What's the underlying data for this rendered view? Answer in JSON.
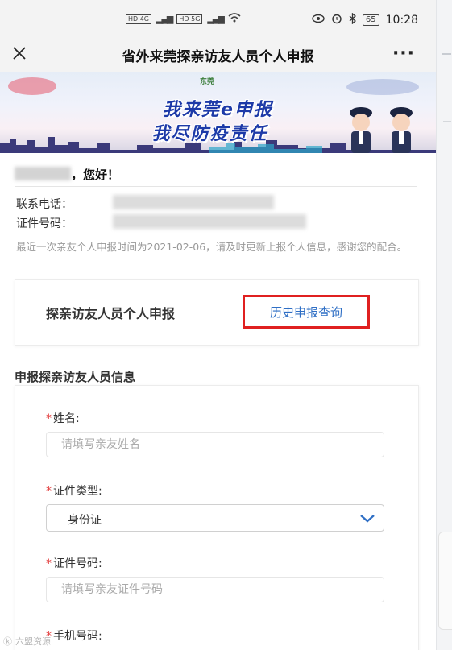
{
  "status_bar": {
    "network_left": "HD 4G",
    "network_right": "HD 5G",
    "battery": "65",
    "time": "10:28"
  },
  "header": {
    "title": "省外来莞探亲访友人员个人申报",
    "more": "···"
  },
  "banner": {
    "logo_text": "东莞",
    "slogan_line1": "我来莞e申报",
    "slogan_line2": "我尽防疫责任"
  },
  "user": {
    "greeting": "，您好！",
    "phone_label": "联系电话：",
    "id_label": "证件号码：",
    "notice": "最近一次亲友个人申报时间为2021-02-06，请及时更新上报个人信息，感谢您的配合。"
  },
  "report": {
    "title": "探亲访友人员个人申报",
    "history_link": "历史申报查询"
  },
  "form": {
    "section_title": "申报探亲访友人员信息",
    "fields": [
      {
        "required": "*",
        "label": "姓名:",
        "placeholder": "请填写亲友姓名"
      },
      {
        "required": "*",
        "label": "证件类型:",
        "value": "身份证"
      },
      {
        "required": "*",
        "label": "证件号码:",
        "placeholder": "请填写亲友证件号码"
      },
      {
        "required": "*",
        "label": "手机号码:"
      }
    ]
  },
  "watermark": "六盟资源"
}
